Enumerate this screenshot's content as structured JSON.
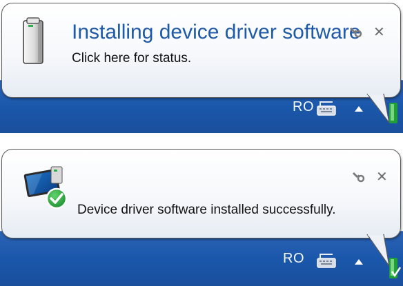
{
  "notifications": [
    {
      "title": "Installing device driver software",
      "message": "Click here for status.",
      "icon": "device-tower-icon",
      "tray": {
        "language": "RO"
      }
    },
    {
      "title": "",
      "message": "Device driver software installed successfully.",
      "icon": "device-installed-check-icon",
      "tray": {
        "language": "RO"
      }
    }
  ],
  "colors": {
    "taskbar": "#1a57ab",
    "title_text": "#1e5aa8",
    "success_green": "#1f9e3a"
  }
}
